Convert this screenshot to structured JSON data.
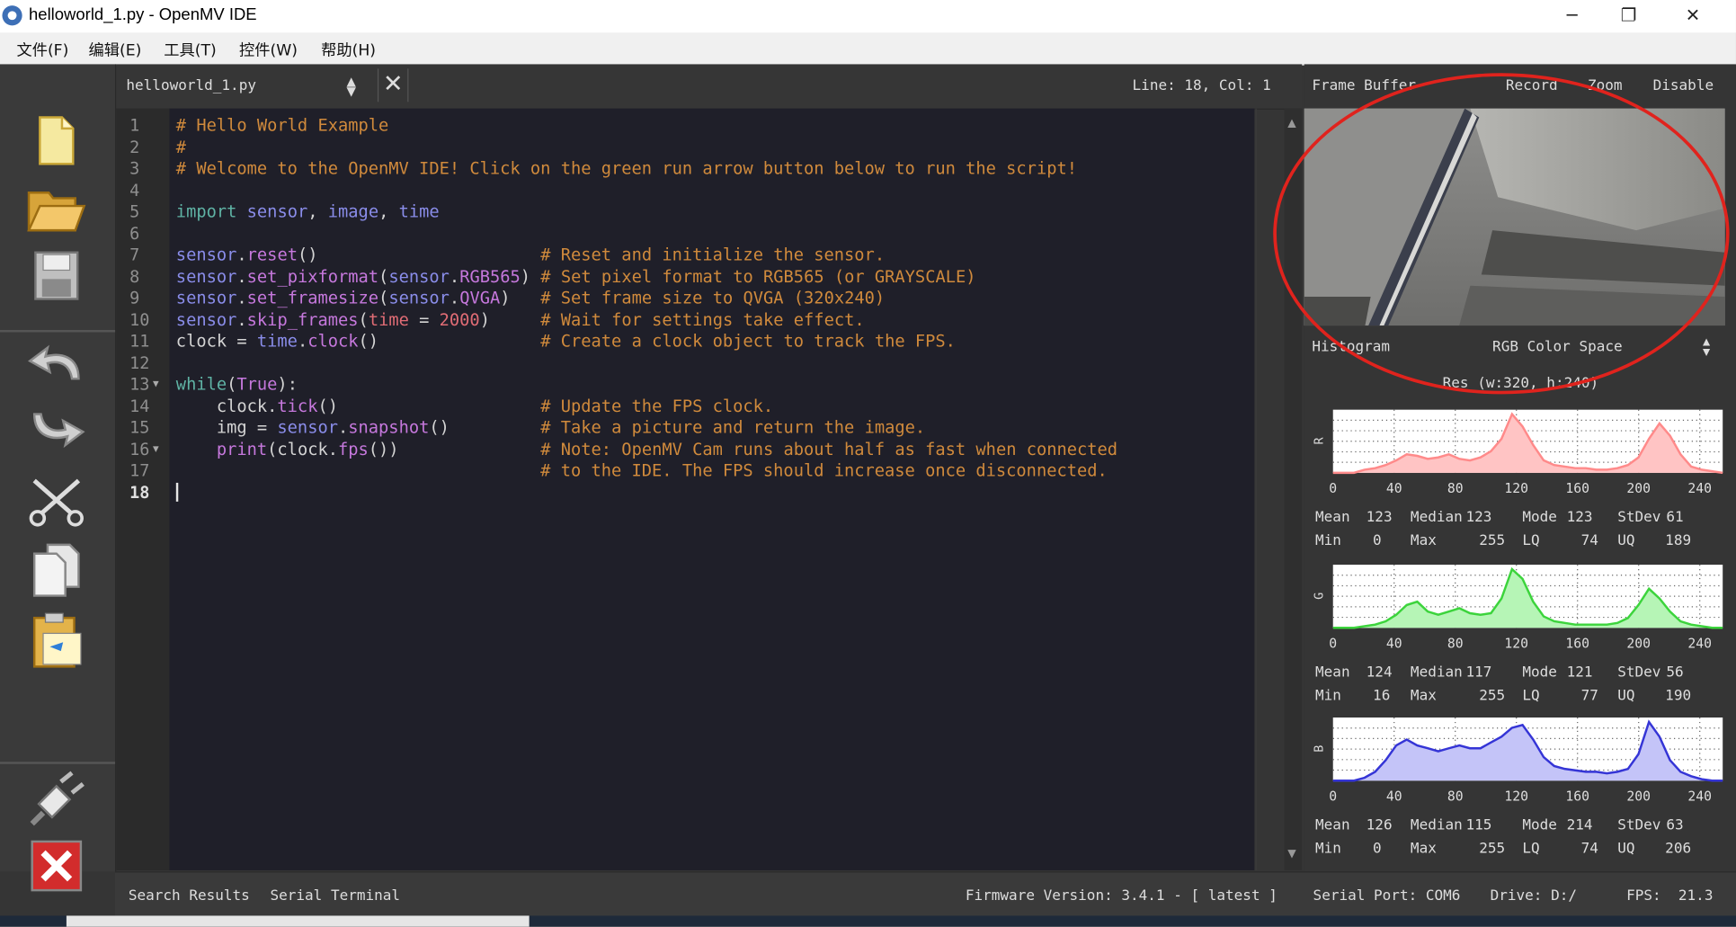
{
  "window": {
    "title": "helloworld_1.py - OpenMV IDE",
    "minimize_label": "─",
    "restore_label": "❐",
    "close_label": "✕"
  },
  "menu": [
    "文件(F)",
    "编辑(E)",
    "工具(T)",
    "控件(W)",
    "帮助(H)"
  ],
  "toolbar_icons": [
    "new-file-icon",
    "open-folder-icon",
    "save-icon",
    "undo-icon",
    "redo-icon",
    "cut-icon",
    "copy-icon",
    "paste-icon",
    "connect-icon",
    "stop-icon"
  ],
  "editor": {
    "filename": "helloworld_1.py",
    "cursor_position": "Line: 18, Col: 1",
    "line_numbers": [
      "1",
      "2",
      "3",
      "4",
      "5",
      "6",
      "7",
      "8",
      "9",
      "10",
      "11",
      "12",
      "13",
      "14",
      "15",
      "16",
      "17",
      "18"
    ],
    "lines": [
      "# Hello World Example",
      "#",
      "# Welcome to the OpenMV IDE! Click on the green run arrow button below to run the script!",
      "",
      "import sensor, image, time",
      "",
      "sensor.reset()                      # Reset and initialize the sensor.",
      "sensor.set_pixformat(sensor.RGB565) # Set pixel format to RGB565 (or GRAYSCALE)",
      "sensor.set_framesize(sensor.QVGA)   # Set frame size to QVGA (320x240)",
      "sensor.skip_frames(time = 2000)     # Wait for settings take effect.",
      "clock = time.clock()                # Create a clock object to track the FPS.",
      "",
      "while(True):",
      "    clock.tick()                    # Update the FPS clock.",
      "    img = sensor.snapshot()         # Take a picture and return the image.",
      "    print(clock.fps())              # Note: OpenMV Cam runs about half as fast when connected",
      "                                    # to the IDE. The FPS should increase once disconnected.",
      ""
    ]
  },
  "frame_buffer": {
    "label": "Frame Buffer",
    "record": "Record",
    "zoom": "Zoom",
    "disable": "Disable"
  },
  "histogram": {
    "label": "Histogram",
    "color_space": "RGB Color Space",
    "resolution": "Res (w:320, h:240)",
    "x_ticks": [
      "0",
      "40",
      "80",
      "120",
      "160",
      "200",
      "240"
    ],
    "channels": [
      {
        "name": "R",
        "color": "#ff8a8a",
        "fill": "#ffc4c4",
        "stats": {
          "Mean": "123",
          "Median": "123",
          "Mode": "123",
          "StDev": "61",
          "Min": "0",
          "Max": "255",
          "LQ": "74",
          "UQ": "189"
        }
      },
      {
        "name": "G",
        "color": "#3cd43c",
        "fill": "#b6f5b6",
        "stats": {
          "Mean": "124",
          "Median": "117",
          "Mode": "121",
          "StDev": "56",
          "Min": "16",
          "Max": "255",
          "LQ": "77",
          "UQ": "190"
        }
      },
      {
        "name": "B",
        "color": "#3535d6",
        "fill": "#c4c4f8",
        "stats": {
          "Mean": "126",
          "Median": "115",
          "Mode": "214",
          "StDev": "63",
          "Min": "0",
          "Max": "255",
          "LQ": "74",
          "UQ": "206"
        }
      }
    ]
  },
  "status": {
    "search_results": "Search Results",
    "serial_terminal": "Serial Terminal",
    "firmware": "Firmware Version: 3.4.1 - [ latest ]",
    "serial_port": "Serial Port: COM6",
    "drive": "Drive: D:/",
    "fps": "FPS:  21.3"
  },
  "annotation_color": "#e0231d"
}
